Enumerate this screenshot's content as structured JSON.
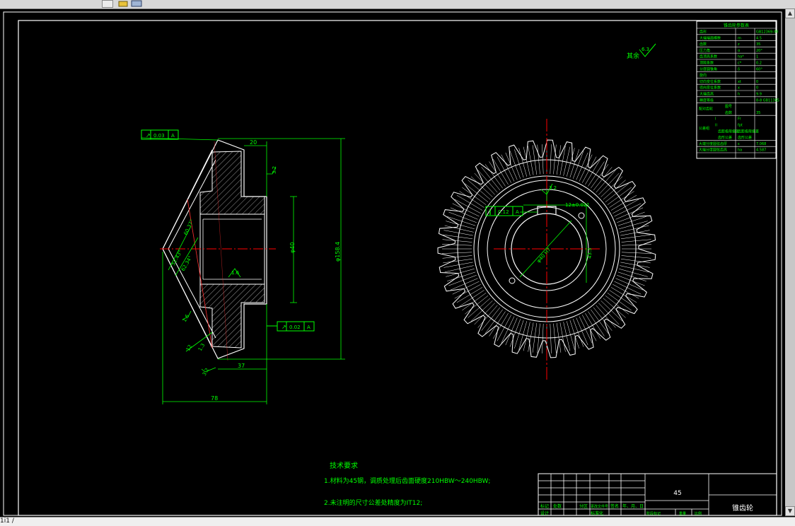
{
  "colors": {
    "background": "#000000",
    "line": "#ffffff",
    "dimension": "#00ff00",
    "centerline": "#ff0000",
    "section": "#ff2020"
  },
  "icons": [
    "print-icon",
    "open-icon"
  ],
  "status": {
    "coords": "1i1 /"
  },
  "drawing": {
    "roughness_note": "其余",
    "roughness_value": "6.3",
    "param_table": {
      "title": "锥齿轮参数表",
      "rows": [
        [
          "齿形",
          "",
          "GB12369-90"
        ],
        [
          "大端端面模数",
          "m",
          "4.5"
        ],
        [
          "齿数",
          "z",
          "35"
        ],
        [
          "压力角",
          "α",
          "20°"
        ],
        [
          "齿顶高系数",
          "ha*",
          "1"
        ],
        [
          "顶隙系数",
          "c*",
          "0.2"
        ],
        [
          "分度圆锥角",
          "δ",
          "60°"
        ],
        [
          "旋向",
          "",
          ""
        ],
        [
          "切向变位系数",
          "xt",
          "0"
        ],
        [
          "径向变位系数",
          "x",
          "0"
        ],
        [
          "大端齿高",
          "h",
          "9.9"
        ],
        [
          "精度等级",
          "",
          "8-8 GB11365"
        ]
      ],
      "pair_label": "配对齿轮",
      "pair_rows": [
        [
          "图号",
          ""
        ],
        [
          "齿数",
          "35"
        ]
      ],
      "check_label": "公差组",
      "check_rows": [
        [
          "I",
          "Fr",
          ""
        ],
        [
          "II",
          "fpt",
          ""
        ],
        [
          "",
          "齿距极限偏差",
          ""
        ],
        [
          "",
          "齿形公差",
          ""
        ]
      ],
      "bottom_rows": [
        [
          "大端分度圆弦齿厚",
          "s",
          "7.068"
        ],
        [
          "大端分度圆弦齿高",
          "ha",
          "4.587"
        ]
      ]
    },
    "side_view": {
      "fcf_top": [
        "↗",
        "0.03",
        "A"
      ],
      "fcf_bottom": [
        "↗",
        "0.02",
        "A"
      ],
      "dims": {
        "d20": "20",
        "phi40": "φ40",
        "phi158": "φ158.4",
        "d37": "37",
        "d78": "78",
        "r32": "3.2",
        "r16": "1.6",
        "r16b": "1.6",
        "a6037": "60.37°",
        "a5243": "52.43°",
        "a6234": "62.34°",
        "d12": "12",
        "d13": "1.3",
        "r32b": "3.2"
      }
    },
    "front_view": {
      "fcf_left": [
        "∥",
        "0.12",
        "A"
      ],
      "r_top": "3.2",
      "keyway": "12±0.021",
      "bore": "φ40 H7",
      "keydepth": "43.3"
    },
    "tech_title": "技术要求",
    "tech_notes": [
      "1.材料为45钢，调质处理后齿面硬度210HBW～240HBW;",
      "2.未注明的尺寸公差处精度为IT12;"
    ],
    "title_block": {
      "material": "45",
      "part_name": "锥齿轮",
      "headers": [
        "标记",
        "处数",
        "分区",
        "更改文件号",
        "签名",
        "年、月、日"
      ],
      "row2": [
        "设计",
        "",
        "",
        "标准化",
        "",
        ""
      ],
      "stage": [
        "阶段标记",
        "重量",
        "比例"
      ]
    }
  }
}
